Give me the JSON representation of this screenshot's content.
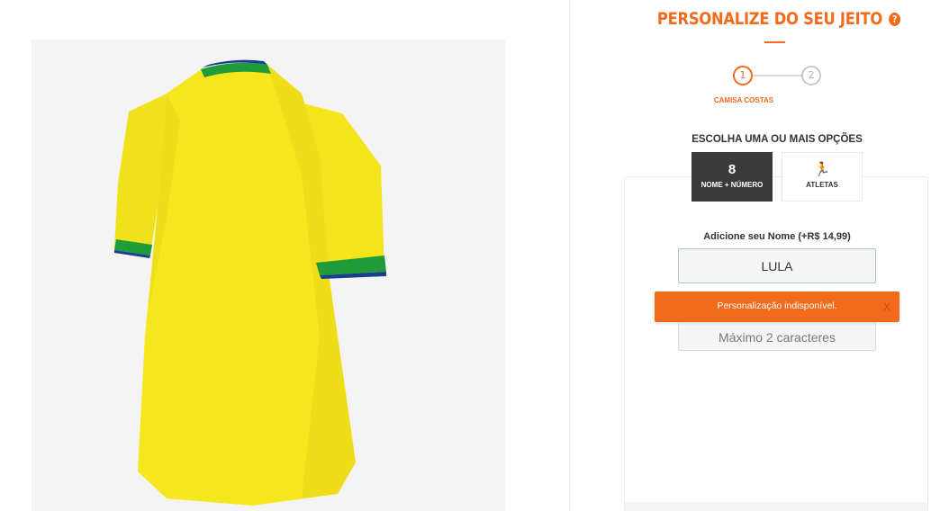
{
  "product": {
    "image_alt": "camisa amarela vista de costas",
    "colors": {
      "shirt": "#f6e61c",
      "collar_green": "#1f9b3a",
      "collar_blue": "#1b3f8f"
    }
  },
  "panel": {
    "title": "PERSONALIZE DO SEU JEITO",
    "help_icon": "?",
    "steps": [
      {
        "number": "1"
      },
      {
        "number": "2"
      }
    ],
    "active_step_label": "CAMISA COSTAS",
    "options_title": "ESCOLHA UMA OU MAIS OPÇÕES",
    "options": [
      {
        "label": "NOME + NÚMERO",
        "icon": "shirt-number-icon",
        "glyph": "8"
      },
      {
        "label": "ATLETAS",
        "icon": "runner-icon",
        "glyph": "🏃"
      }
    ],
    "name_label": "Adicione seu Nome (+R$ 14,99)",
    "name_value": "LULA",
    "number_placeholder": "Máximo 2 caracteres",
    "toast": {
      "message": "Personalização indisponível.",
      "close": "X"
    },
    "accent_color": "#f26a1b"
  }
}
